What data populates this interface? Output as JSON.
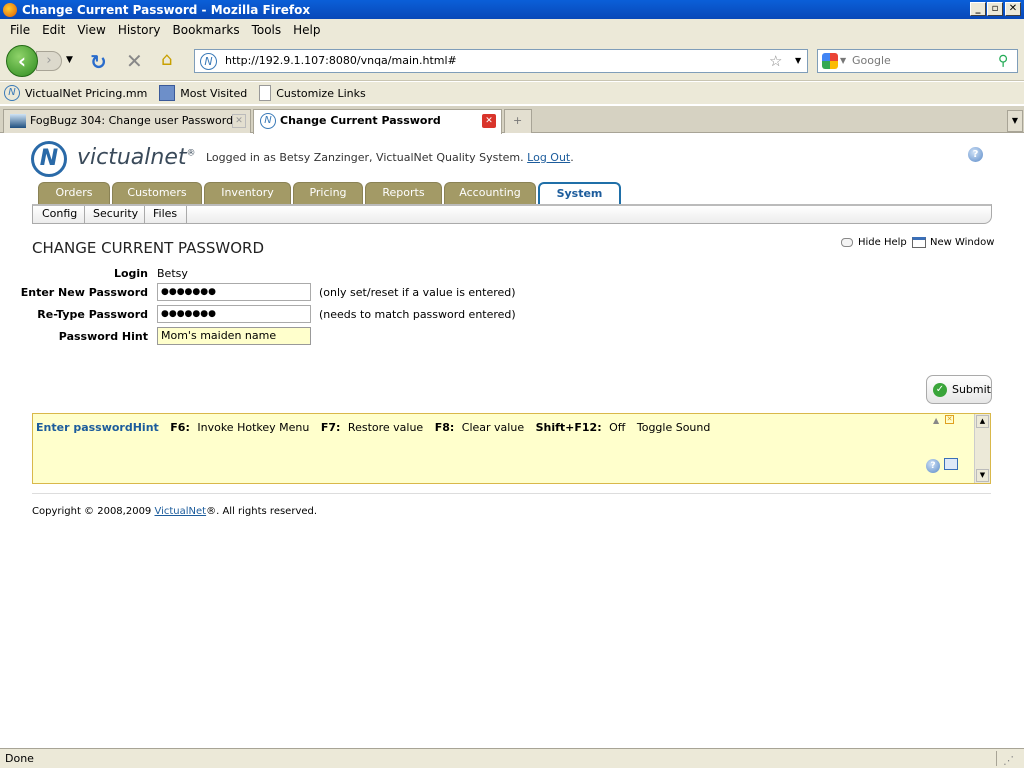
{
  "window": {
    "title": "Change Current Password - Mozilla Firefox"
  },
  "menu": [
    "File",
    "Edit",
    "View",
    "History",
    "Bookmarks",
    "Tools",
    "Help"
  ],
  "nav": {
    "url": "http://192.9.1.107:8080/vnqa/main.html#",
    "search_placeholder": "Google"
  },
  "bookmarks": [
    "VictualNet Pricing.mm",
    "Most Visited",
    "Customize Links"
  ],
  "browser_tabs": [
    {
      "label": "FogBugz 304: Change user Password"
    },
    {
      "label": "Change Current Password"
    }
  ],
  "header": {
    "logo": "victualnet",
    "logo_mark": "®",
    "logged_in_text": "Logged in as Betsy Zanzinger, VictualNet Quality System.",
    "logout_label": "Log Out",
    "logout_suffix": "."
  },
  "app_tabs": [
    "Orders",
    "Customers",
    "Inventory",
    "Pricing",
    "Reports",
    "Accounting",
    "System"
  ],
  "sub_tabs": [
    "Config",
    "Security",
    "Files"
  ],
  "page": {
    "title": "CHANGE CURRENT PASSWORD",
    "hide_help": "Hide Help",
    "new_window": "New Window"
  },
  "form": {
    "login_label": "Login",
    "login_value": "Betsy",
    "new_password_label": "Enter New Password",
    "new_password_value": "●●●●●●●",
    "new_password_note": "(only set/reset if a value is entered)",
    "retype_label": "Re-Type Password",
    "retype_value": "●●●●●●●",
    "retype_note": "(needs to match password entered)",
    "hint_label": "Password Hint",
    "hint_value": "Mom's maiden name",
    "submit_label": "Submit"
  },
  "help": {
    "field": "Enter passwordHint",
    "f6_key": "F6:",
    "f6_text": "Invoke Hotkey Menu",
    "f7_key": "F7:",
    "f7_text": "Restore value",
    "f8_key": "F8:",
    "f8_text": "Clear value",
    "sf12_key": "Shift+F12:",
    "sf12_val": "Off",
    "sf12_text": "Toggle Sound"
  },
  "footer": {
    "prefix": "Copyright © 2008,2009 ",
    "link": "VictualNet",
    "suffix": "®. All rights reserved."
  },
  "status": "Done"
}
